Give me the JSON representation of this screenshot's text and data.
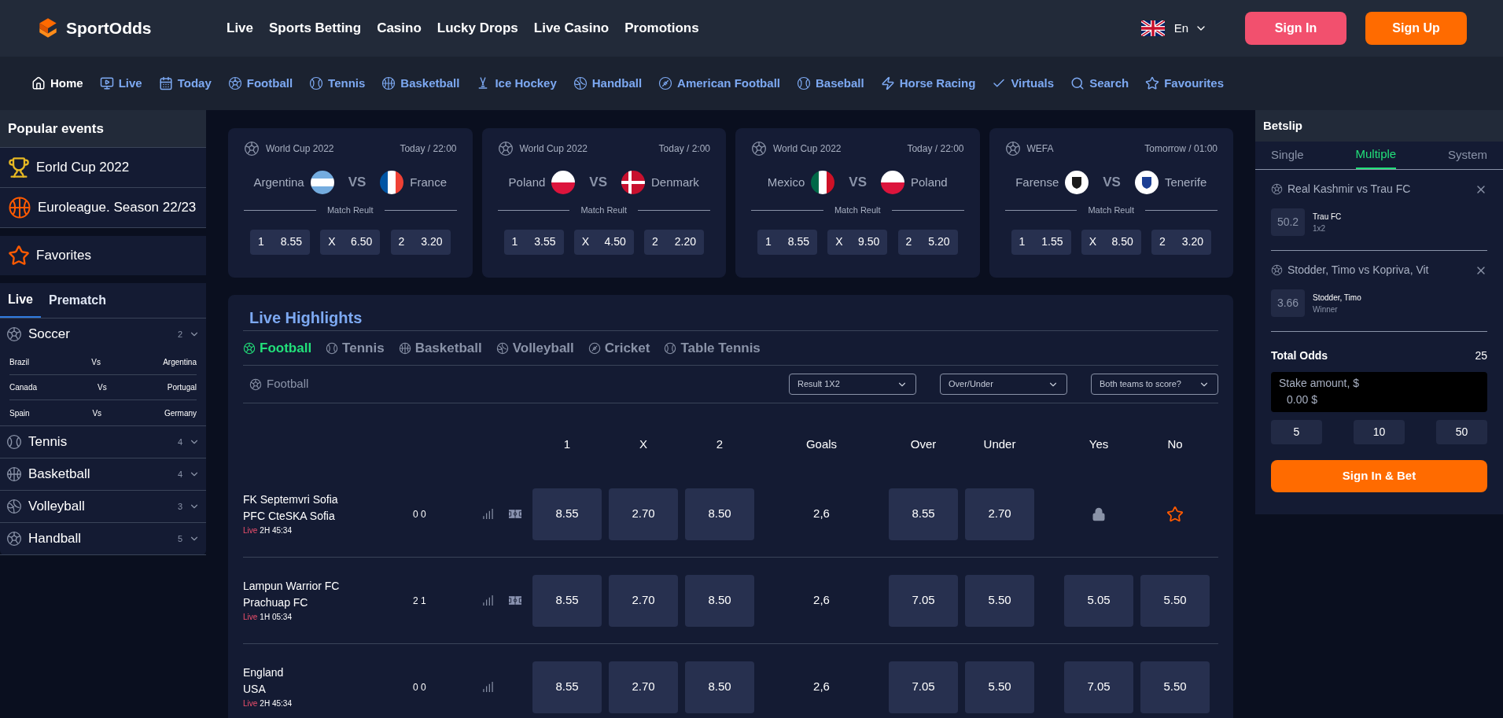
{
  "brand": {
    "name": "SportOdds"
  },
  "top_nav": [
    "Live",
    "Sports Betting",
    "Casino",
    "Lucky Drops",
    "Live Casino",
    "Promotions"
  ],
  "language": {
    "label": "En"
  },
  "auth_buttons": [
    {
      "label": "Sign In",
      "kind": "secondary"
    },
    {
      "label": "Sign Up",
      "kind": "primary"
    }
  ],
  "sport_nav": [
    {
      "label": "Home",
      "selected": true
    },
    {
      "label": "Live",
      "selected": false
    },
    {
      "label": "Today",
      "selected": false
    },
    {
      "label": "Football",
      "selected": false
    },
    {
      "label": "Tennis",
      "selected": false
    },
    {
      "label": "Basketball",
      "selected": false
    },
    {
      "label": "Ice Hockey",
      "selected": false
    },
    {
      "label": "Handball",
      "selected": false
    },
    {
      "label": "American Football",
      "selected": false
    },
    {
      "label": "Baseball",
      "selected": false
    },
    {
      "label": "Horse Racing",
      "selected": false
    },
    {
      "label": "Virtuals",
      "selected": false
    },
    {
      "label": "Search",
      "selected": false
    },
    {
      "label": "Favourites",
      "selected": false
    }
  ],
  "sidebar": {
    "popular_title": "Popular events",
    "popular_items": [
      {
        "label": "Eorld Cup 2022"
      },
      {
        "label": "Euroleague. Season 22/23"
      }
    ],
    "favorites": "Favorites",
    "tabs": [
      {
        "label": "Live",
        "selected": true
      },
      {
        "label": "Prematch",
        "selected": false
      }
    ],
    "sports": [
      {
        "name": "Soccer",
        "count": "2",
        "matches": [
          {
            "home": "Brazil",
            "vs": "Vs",
            "away": "Argentina"
          },
          {
            "home": "Canada",
            "vs": "Vs",
            "away": "Portugal"
          },
          {
            "home": "Spain",
            "vs": "Vs",
            "away": "Germany"
          }
        ]
      },
      {
        "name": "Tennis",
        "count": "4"
      },
      {
        "name": "Basketball",
        "count": "4"
      },
      {
        "name": "Volleyball",
        "count": "3"
      },
      {
        "name": "Handball",
        "count": "5"
      }
    ]
  },
  "event_cards": [
    {
      "league": "World Cup 2022",
      "time": "Today / 22:00",
      "home": "Argentina",
      "vs": "VS",
      "away": "France",
      "market": "Match Reult",
      "odds": [
        {
          "label": "1",
          "value": "8.55"
        },
        {
          "label": "X",
          "value": "6.50"
        },
        {
          "label": "2",
          "value": "3.20"
        }
      ]
    },
    {
      "league": "World Cup 2022",
      "time": "Today / 2:00",
      "home": "Poland",
      "vs": "VS",
      "away": "Denmark",
      "market": "Match Reult",
      "odds": [
        {
          "label": "1",
          "value": "3.55"
        },
        {
          "label": "X",
          "value": "4.50"
        },
        {
          "label": "2",
          "value": "2.20"
        }
      ]
    },
    {
      "league": "World Cup 2022",
      "time": "Today / 22:00",
      "home": "Mexico",
      "vs": "VS",
      "away": "Poland",
      "market": "Match Reult",
      "odds": [
        {
          "label": "1",
          "value": "8.55"
        },
        {
          "label": "X",
          "value": "9.50"
        },
        {
          "label": "2",
          "value": "5.20"
        }
      ]
    },
    {
      "league": "WEFA",
      "time": "Tomorrow / 01:00",
      "home": "Farense",
      "vs": "VS",
      "away": "Tenerife",
      "market": "Match Reult",
      "odds": [
        {
          "label": "1",
          "value": "1.55"
        },
        {
          "label": "X",
          "value": "8.50"
        },
        {
          "label": "2",
          "value": "3.20"
        }
      ]
    }
  ],
  "live_highlights": {
    "title": "Live Highlights",
    "tabs": [
      {
        "label": "Football",
        "selected": true
      },
      {
        "label": "Tennis",
        "selected": false
      },
      {
        "label": "Basketball",
        "selected": false
      },
      {
        "label": "Volleyball",
        "selected": false
      },
      {
        "label": "Cricket",
        "selected": false
      },
      {
        "label": "Table Tennis",
        "selected": false
      }
    ],
    "filter_label": "Football",
    "selects": [
      "Result 1X2",
      "Over/Under",
      "Both teams to score?"
    ],
    "columns": [
      "1",
      "X",
      "2",
      "Goals",
      "Over",
      "Under",
      "Yes",
      "No"
    ],
    "rows": [
      {
        "home": "FK Septemvri Sofia",
        "away": "PFC CteSKA Sofia",
        "live": "Live",
        "time": "2H 45:34",
        "score": "0 0",
        "field_icon": true,
        "cells": [
          {
            "kind": "odd",
            "value": "8.55"
          },
          {
            "kind": "odd",
            "value": "2.70"
          },
          {
            "kind": "odd",
            "value": "8.50"
          },
          {
            "kind": "text",
            "value": "2,6"
          },
          {
            "kind": "odd",
            "value": "8.55"
          },
          {
            "kind": "odd",
            "value": "2.70"
          },
          {
            "kind": "lock"
          },
          {
            "kind": "star"
          }
        ]
      },
      {
        "home": "Lampun Warrior FC",
        "away": "Prachuap FC",
        "live": "Live",
        "time": "1H 05:34",
        "score": "2 1",
        "field_icon": true,
        "cells": [
          {
            "kind": "odd",
            "value": "8.55"
          },
          {
            "kind": "odd",
            "value": "2.70"
          },
          {
            "kind": "odd",
            "value": "8.50"
          },
          {
            "kind": "text",
            "value": "2,6"
          },
          {
            "kind": "odd",
            "value": "7.05"
          },
          {
            "kind": "odd",
            "value": "5.50"
          },
          {
            "kind": "odd",
            "value": "5.05"
          },
          {
            "kind": "odd",
            "value": "5.50"
          }
        ]
      },
      {
        "home": "England",
        "away": "USA",
        "live": "Live",
        "time": "2H 45:34",
        "score": "0 0",
        "field_icon": false,
        "cells": [
          {
            "kind": "odd",
            "value": "8.55"
          },
          {
            "kind": "odd",
            "value": "2.70"
          },
          {
            "kind": "odd",
            "value": "8.50"
          },
          {
            "kind": "text",
            "value": "2,6"
          },
          {
            "kind": "odd",
            "value": "7.05"
          },
          {
            "kind": "odd",
            "value": "5.50"
          },
          {
            "kind": "odd",
            "value": "7.05"
          },
          {
            "kind": "odd",
            "value": "5.50"
          }
        ]
      }
    ]
  },
  "betslip": {
    "title": "Betslip",
    "tabs": [
      {
        "label": "Single",
        "selected": false
      },
      {
        "label": "Multiple",
        "selected": true
      },
      {
        "label": "System",
        "selected": false
      }
    ],
    "bets": [
      {
        "event": "Real Kashmir vs Trau FC",
        "odds": "50.2",
        "selection": "Trau FC",
        "market": "1x2"
      },
      {
        "event": "Stodder, Timo vs Kopriva, Vit",
        "odds": "3.66",
        "selection": "Stodder, Timo",
        "market": "Winner"
      }
    ],
    "total_label": "Total Odds",
    "total": "25",
    "stake": {
      "label": "Stake amount, $",
      "placeholder": "0.00 $"
    },
    "quick_amounts": [
      "5",
      "10",
      "50"
    ],
    "submit": "Sign In & Bet"
  }
}
